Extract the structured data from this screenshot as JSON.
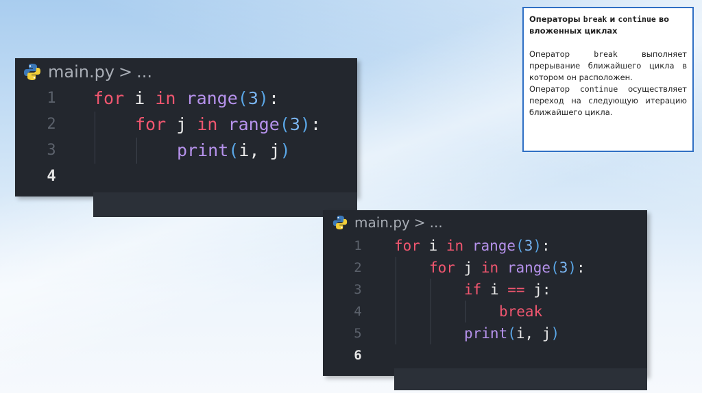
{
  "editor1": {
    "filename": "main.py",
    "breadcrumb_sep": ">",
    "breadcrumb_more": "...",
    "current_line": 4,
    "lines": [
      {
        "num": "1",
        "indent": 0,
        "tokens": [
          [
            "kw",
            "for"
          ],
          [
            "p",
            " "
          ],
          [
            "id",
            "i"
          ],
          [
            "p",
            " "
          ],
          [
            "kw",
            "in"
          ],
          [
            "p",
            " "
          ],
          [
            "fn",
            "range"
          ],
          [
            "pn",
            "("
          ],
          [
            "num",
            "3"
          ],
          [
            "pn",
            ")"
          ],
          [
            "p",
            ":"
          ]
        ]
      },
      {
        "num": "2",
        "indent": 1,
        "tokens": [
          [
            "kw",
            "for"
          ],
          [
            "p",
            " "
          ],
          [
            "id",
            "j"
          ],
          [
            "p",
            " "
          ],
          [
            "kw",
            "in"
          ],
          [
            "p",
            " "
          ],
          [
            "fn",
            "range"
          ],
          [
            "pn",
            "("
          ],
          [
            "num",
            "3"
          ],
          [
            "pn",
            ")"
          ],
          [
            "p",
            ":"
          ]
        ]
      },
      {
        "num": "3",
        "indent": 2,
        "tokens": [
          [
            "fn",
            "print"
          ],
          [
            "pn",
            "("
          ],
          [
            "id",
            "i"
          ],
          [
            "p",
            ", "
          ],
          [
            "id",
            "j"
          ],
          [
            "pn",
            ")"
          ]
        ]
      },
      {
        "num": "4",
        "indent": 0,
        "tokens": []
      }
    ]
  },
  "editor2": {
    "filename": "main.py",
    "breadcrumb_sep": ">",
    "breadcrumb_more": "...",
    "current_line": 6,
    "lines": [
      {
        "num": "1",
        "indent": 0,
        "tokens": [
          [
            "kw",
            "for"
          ],
          [
            "p",
            " "
          ],
          [
            "id",
            "i"
          ],
          [
            "p",
            " "
          ],
          [
            "kw",
            "in"
          ],
          [
            "p",
            " "
          ],
          [
            "fn",
            "range"
          ],
          [
            "pn",
            "("
          ],
          [
            "num",
            "3"
          ],
          [
            "pn",
            ")"
          ],
          [
            "p",
            ":"
          ]
        ]
      },
      {
        "num": "2",
        "indent": 1,
        "tokens": [
          [
            "kw",
            "for"
          ],
          [
            "p",
            " "
          ],
          [
            "id",
            "j"
          ],
          [
            "p",
            " "
          ],
          [
            "kw",
            "in"
          ],
          [
            "p",
            " "
          ],
          [
            "fn",
            "range"
          ],
          [
            "pn",
            "("
          ],
          [
            "num",
            "3"
          ],
          [
            "pn",
            ")"
          ],
          [
            "p",
            ":"
          ]
        ]
      },
      {
        "num": "3",
        "indent": 2,
        "tokens": [
          [
            "kw",
            "if"
          ],
          [
            "p",
            " "
          ],
          [
            "id",
            "i"
          ],
          [
            "p",
            " "
          ],
          [
            "op",
            "=="
          ],
          [
            "p",
            " "
          ],
          [
            "id",
            "j"
          ],
          [
            "p",
            ":"
          ]
        ]
      },
      {
        "num": "4",
        "indent": 3,
        "tokens": [
          [
            "kw",
            "break"
          ]
        ]
      },
      {
        "num": "5",
        "indent": 2,
        "tokens": [
          [
            "fn",
            "print"
          ],
          [
            "pn",
            "("
          ],
          [
            "id",
            "i"
          ],
          [
            "p",
            ", "
          ],
          [
            "id",
            "j"
          ],
          [
            "pn",
            ")"
          ]
        ]
      },
      {
        "num": "6",
        "indent": 0,
        "tokens": []
      }
    ]
  },
  "note": {
    "title_a": "Операторы ",
    "title_b": "break",
    "title_c": " и ",
    "title_d": "continue",
    "title_e": " во вложенных циклах",
    "p1_a": "Оператор ",
    "p1_b": "break",
    "p1_c": " выполняет прерывание ближайшего цикла в котором он расположен.",
    "p2_a": "Оператор ",
    "p2_b": "continue",
    "p2_c": " осуществляет переход на следующую итерацию ближайшего цикла."
  }
}
